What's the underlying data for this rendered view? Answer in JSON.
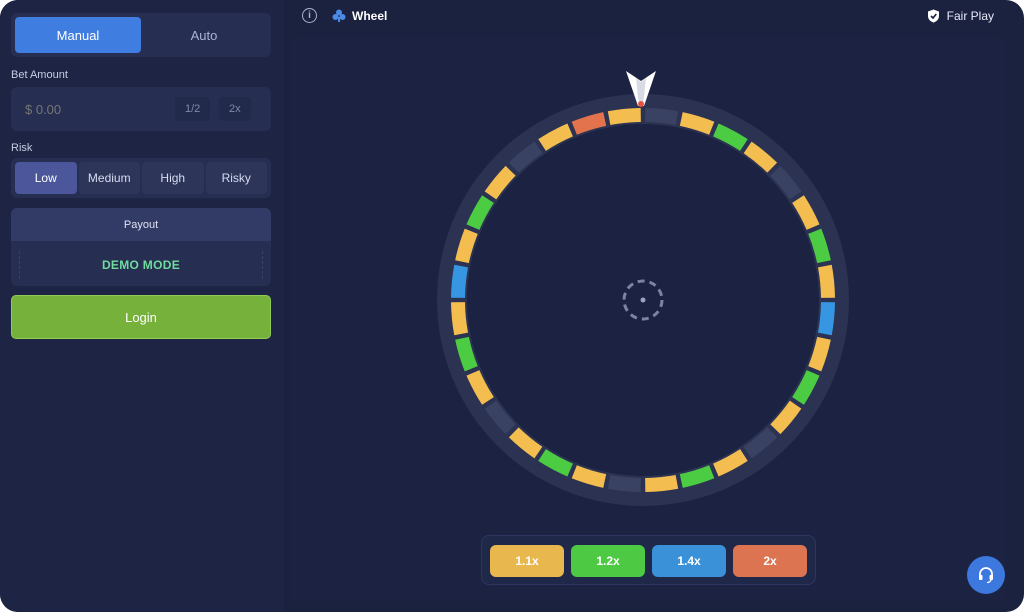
{
  "mode_tabs": {
    "manual": "Manual",
    "auto": "Auto",
    "active": "manual"
  },
  "bet": {
    "label": "Bet Amount",
    "placeholder": "$ 0.00",
    "half_label": "1/2",
    "double_label": "2x"
  },
  "risk": {
    "label": "Risk",
    "options": [
      "Low",
      "Medium",
      "High",
      "Risky"
    ],
    "selected": "Low"
  },
  "payout": {
    "title": "Payout",
    "status": "DEMO MODE"
  },
  "login_label": "Login",
  "topbar": {
    "game_title": "Wheel",
    "fair_play": "Fair Play",
    "info_icon": "info-icon",
    "game_icon": "diamond-icon",
    "fair_icon": "shield-check-icon"
  },
  "wheel": {
    "segments": [
      "dark",
      "yellow",
      "green",
      "yellow",
      "dark",
      "yellow",
      "green",
      "yellow",
      "blue",
      "yellow",
      "green",
      "yellow",
      "dark",
      "yellow",
      "green",
      "yellow",
      "dark",
      "yellow",
      "green",
      "yellow",
      "dark",
      "yellow",
      "green",
      "yellow",
      "blue",
      "yellow",
      "green",
      "yellow",
      "dark",
      "yellow",
      "orange",
      "yellow"
    ],
    "colors": {
      "dark": "#3a4263",
      "yellow": "#f3bd4f",
      "green": "#4ccc43",
      "blue": "#3796e1",
      "orange": "#e2734d"
    }
  },
  "multipliers": [
    {
      "label": "1.1x",
      "color": "#e8b84f"
    },
    {
      "label": "1.2x",
      "color": "#4dc944"
    },
    {
      "label": "1.4x",
      "color": "#3a91d8"
    },
    {
      "label": "2x",
      "color": "#dd7451"
    }
  ],
  "support_icon": "headset-icon"
}
